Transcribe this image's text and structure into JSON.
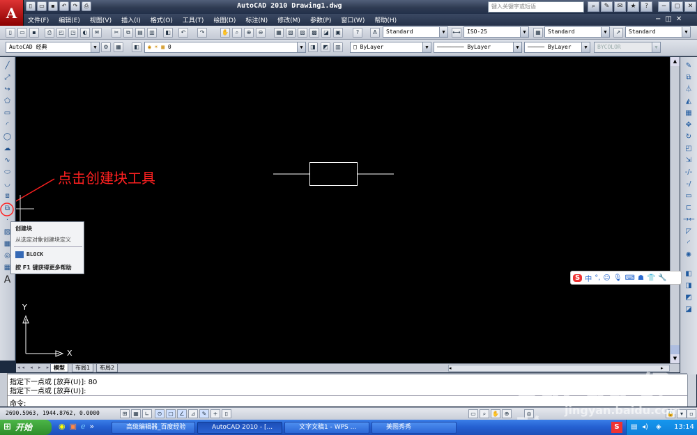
{
  "title_bar": {
    "app_title": "AutoCAD 2010  Drawing1.dwg",
    "search_placeholder": "键入关键字或短语",
    "window_buttons": [
      "−",
      "◻",
      "✕"
    ]
  },
  "menu": [
    "文件(F)",
    "编辑(E)",
    "视图(V)",
    "插入(I)",
    "格式(O)",
    "工具(T)",
    "绘图(D)",
    "标注(N)",
    "修改(M)",
    "参数(P)",
    "窗口(W)",
    "帮助(H)"
  ],
  "styles_toolbar": {
    "text_style": "Standard",
    "dim_style": "ISO-25",
    "table_style": "Standard",
    "multileader_style": "Standard"
  },
  "layers_toolbar": {
    "workspace": "AutoCAD 经典",
    "layer": "0",
    "color": "ByLayer",
    "linetype": "ByLayer",
    "lineweight": "ByLayer",
    "plotstyle": "BYCOLOR"
  },
  "annotation": {
    "text": "点击创建块工具",
    "color": "#ff2020"
  },
  "tooltip": {
    "title": "创建块",
    "description": "从选定对象创建块定义",
    "command": "BLOCK",
    "help": "按 F1 键获得更多帮助"
  },
  "ucs": {
    "x_label": "X",
    "y_label": "Y"
  },
  "layout_tabs": [
    "模型",
    "布局1",
    "布局2"
  ],
  "command_area": {
    "lines": [
      "指定下一点或 [放弃(U)]: 80",
      "指定下一点或 [放弃(U)]:"
    ],
    "prompt": "命令:"
  },
  "status_bar": {
    "coordinates": "2690.5963, 1944.8762, 0.0000"
  },
  "ime_bar": {
    "mode": "中"
  },
  "taskbar": {
    "start_label": "开始",
    "windows": [
      "高级编辑器_百度经验",
      "AutoCAD 2010 - [...",
      "文字文稿1 - WPS ...",
      "美图秀秀"
    ],
    "clock": "13:14"
  },
  "watermark": {
    "text": "Bai du 经验",
    "url": "jingyan.baidu.com"
  }
}
